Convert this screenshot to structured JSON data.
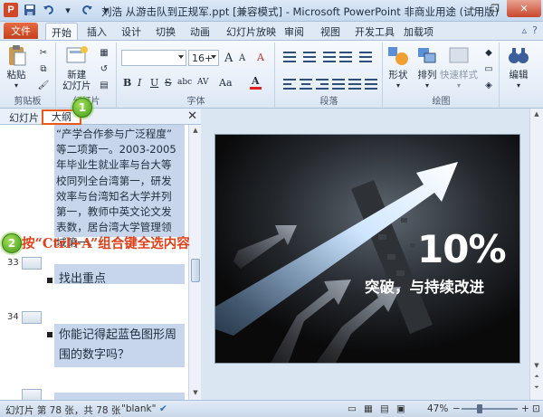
{
  "window": {
    "title": "刘浩 从游击队到正规军.ppt [兼容模式] - Microsoft PowerPoint 非商业用途 (试用版)",
    "app_icon": "P"
  },
  "ribbon_tabs": {
    "file": "文件",
    "tabs": [
      "开始",
      "插入",
      "设计",
      "切换",
      "动画",
      "幻灯片放映",
      "审阅",
      "视图",
      "开发工具",
      "加载项"
    ],
    "active": "开始"
  },
  "ribbon": {
    "clipboard": {
      "paste": "粘贴",
      "label": "剪贴板"
    },
    "slides": {
      "new_slide": "新建",
      "new_slide2": "幻灯片",
      "label": "幻灯片"
    },
    "font": {
      "font_name": "",
      "font_size": "16+",
      "bold": "B",
      "italic": "I",
      "underline": "U",
      "strike": "S",
      "shadow": "abc",
      "spacing": "AV",
      "case": "Aa",
      "color": "A",
      "grow": "A",
      "shrink": "A",
      "clear": "A",
      "label": "字体"
    },
    "paragraph": {
      "label": "段落"
    },
    "drawing": {
      "shapes": "形状",
      "arrange": "排列",
      "quick_styles": "快速样式",
      "label": "绘图"
    },
    "editing": {
      "edit": "编辑"
    }
  },
  "pane": {
    "tab_slides": "幻灯片",
    "tab_outline": "大纲",
    "close": "✕"
  },
  "outline": {
    "lines": [
      "“产学合作参与广泛程度”",
      "等二项第一。2003-2005",
      "年毕业生就业率与台大等",
      "校同列全台湾第一，研发",
      "效率与台湾知名大学并列",
      "第一，教师中英文论文发",
      "表数，居台湾大学管理领",
      "域第一。"
    ],
    "slide33_num": "33",
    "slide33_bullet": "找出重点",
    "slide34_num": "34",
    "slide34_line1": "你能记得起蓝色图形周",
    "slide34_line2": "围的数字吗？"
  },
  "annotations": {
    "badge1": "1",
    "badge2": "2",
    "instruction": "按“Ctrl+A”组合键全选内容"
  },
  "slide": {
    "big_text": "10%",
    "sub_text": "突破，与持续改进"
  },
  "status": {
    "slide_info": "幻灯片 第 78 张，共 78 张",
    "theme": "\"blank\"",
    "lang_icon": "spell-check",
    "zoom": "47%",
    "zoom_fraction": 0.47
  }
}
